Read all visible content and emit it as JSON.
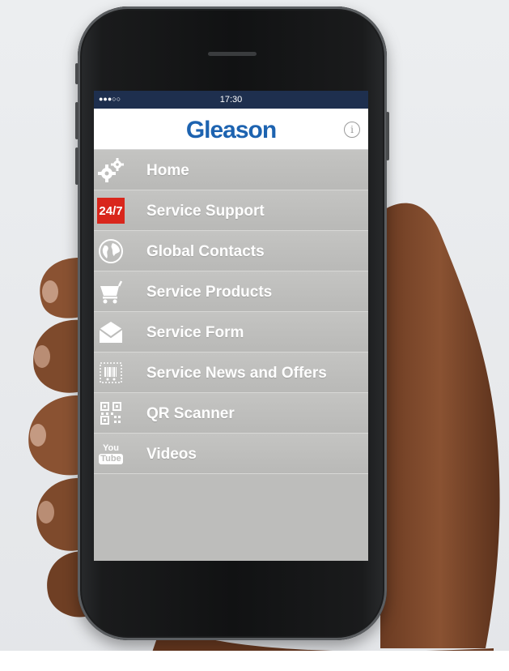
{
  "status_bar": {
    "signal": "●●●○○",
    "time": "17:30"
  },
  "header": {
    "logo": "Gleason",
    "info_icon": "info-icon"
  },
  "menu": {
    "items": [
      {
        "label": "Home",
        "icon": "gears-icon"
      },
      {
        "label": "Service Support",
        "icon": "24-7-icon",
        "badge_text": "24/7"
      },
      {
        "label": "Global Contacts",
        "icon": "globe-icon"
      },
      {
        "label": "Service Products",
        "icon": "cart-icon"
      },
      {
        "label": "Service Form",
        "icon": "envelope-icon"
      },
      {
        "label": "Service News and Offers",
        "icon": "coupon-icon"
      },
      {
        "label": "QR Scanner",
        "icon": "qr-code-icon"
      },
      {
        "label": "Videos",
        "icon": "youtube-icon",
        "badge_top": "You",
        "badge_bottom": "Tube"
      }
    ]
  },
  "colors": {
    "status_bar": "#1e2f4e",
    "logo": "#1d63b0",
    "menu_background": "#bdbdbb",
    "badge_red": "#d9261c"
  }
}
